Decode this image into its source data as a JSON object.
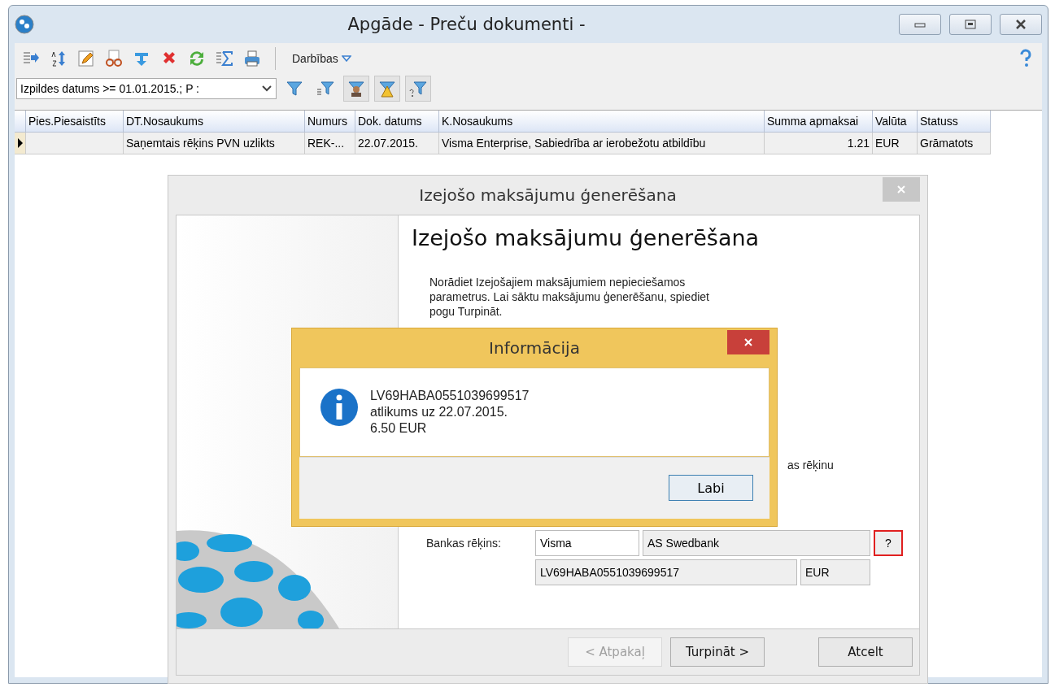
{
  "window": {
    "title": "Apgāde - Preču dokumenti -"
  },
  "toolbar": {
    "actions_menu": "Darbības"
  },
  "filter": {
    "value": "Izpildes datums >= 01.01.2015.; P :"
  },
  "table": {
    "columns": [
      "Pies.Piesaistīts",
      "DT.Nosaukums",
      "Numurs",
      "Dok. datums",
      "K.Nosaukums",
      "Summa apmaksai",
      "Valūta",
      "Statuss"
    ],
    "rows": [
      {
        "selected": true,
        "cells": [
          "",
          "Saņemtais rēķins PVN uzlikts",
          "REK-...",
          "22.07.2015.",
          "Visma Enterprise, Sabiedrība ar ierobežotu atbildību",
          "1.21",
          "EUR",
          "Grāmatots"
        ]
      }
    ]
  },
  "wizard": {
    "title": "Izejošo maksājumu ģenerēšana",
    "heading": "Izejošo maksājumu ģenerēšana",
    "description": "Norādiet Izejošajiem maksājumiem nepieciešamos parametrus. Lai sāktu maksājumu ģenerēšanu, spiediet pogu Turpināt.",
    "partial_text": "as rēķinu",
    "bank_label": "Bankas rēķins:",
    "bank_fields": {
      "code": "Visma",
      "bank": "AS Swedbank",
      "account": "LV69HABA0551039699517",
      "currency": "EUR",
      "lookup": "?"
    },
    "buttons": [
      {
        "label": "< Atpakaļ",
        "disabled": true
      },
      {
        "label": "Turpināt >",
        "disabled": false
      },
      {
        "label": "Atcelt",
        "disabled": false
      }
    ]
  },
  "info_dialog": {
    "title": "Informācija",
    "lines": [
      "LV69HABA0551039699517",
      "atlikums uz 22.07.2015.",
      "6.50 EUR"
    ],
    "button": "Labi"
  }
}
